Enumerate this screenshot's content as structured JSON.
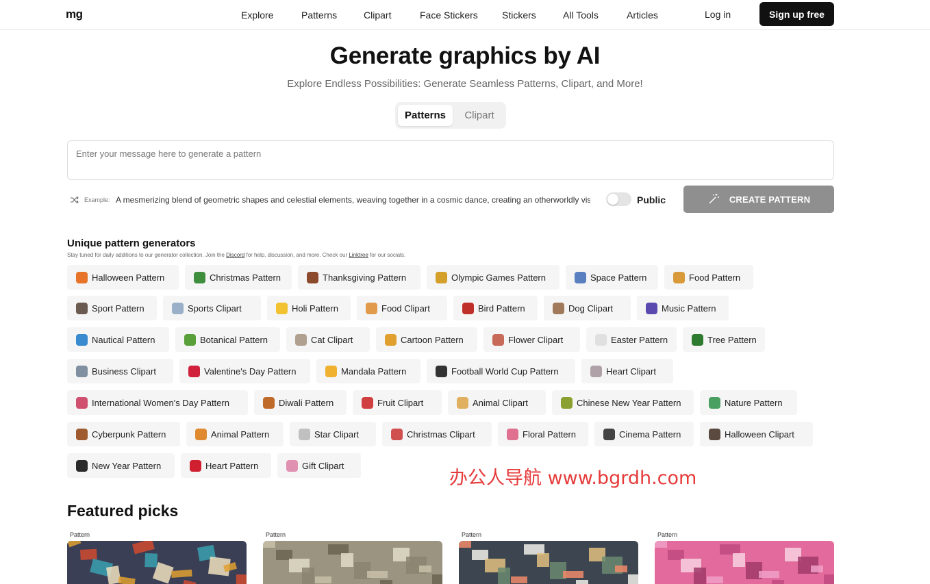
{
  "header": {
    "logo": "mg",
    "nav": [
      "Explore",
      "Patterns",
      "Clipart",
      "Face Stickers",
      "Stickers",
      "All Tools",
      "Articles"
    ],
    "login": "Log in",
    "signup": "Sign up free"
  },
  "hero": {
    "title": "Generate graphics by AI",
    "subtitle": "Explore Endless Possibilities: Generate Seamless Patterns, Clipart, and More!",
    "tabs": [
      "Patterns",
      "Clipart"
    ],
    "prompt_placeholder": "Enter your message here to generate a pattern",
    "example_label": "Example:",
    "example_text": "A mesmerizing blend of geometric shapes and celestial elements, weaving together in a cosmic dance, creating an otherworldly visual experience",
    "public_label": "Public",
    "public_on": false,
    "create_button": "CREATE PATTERN"
  },
  "generators": {
    "title": "Unique pattern generators",
    "note_before": "Stay tuned for daily additions to our generator collection. Join the ",
    "note_link1": "Discord",
    "note_mid": " for help, discussion, and more. Check our ",
    "note_link2": "Linktree",
    "note_after": " for our socials.",
    "chips": [
      "Halloween Pattern",
      "Christmas Pattern",
      "Thanksgiving Pattern",
      "Olympic Games Pattern",
      "Space Pattern",
      "Food Pattern",
      "Sport Pattern",
      "Sports Clipart",
      "Holi Pattern",
      "Food Clipart",
      "Bird Pattern",
      "Dog Clipart",
      "Music Pattern",
      "Nautical Pattern",
      "Botanical Pattern",
      "Cat Clipart",
      "Cartoon Pattern",
      "Flower Clipart",
      "Easter Pattern",
      "Tree Pattern",
      "Business Clipart",
      "Valentine's Day Pattern",
      "Mandala Pattern",
      "Football World Cup Pattern",
      "Heart Clipart",
      "International Women's Day Pattern",
      "Diwali Pattern",
      "Fruit Clipart",
      "Animal Clipart",
      "Chinese New Year Pattern",
      "Nature Pattern",
      "Cyberpunk Pattern",
      "Animal Pattern",
      "Star Clipart",
      "Christmas Clipart",
      "Floral Pattern",
      "Cinema Pattern",
      "Halloween Clipart",
      "New Year Pattern",
      "Heart Pattern",
      "Gift Clipart"
    ],
    "chip_colors": [
      "#e8742a",
      "#3e8e3e",
      "#8b4a2b",
      "#d4a02a",
      "#5a7fc0",
      "#d99a3a",
      "#6a5a50",
      "#9ab0c8",
      "#f2c230",
      "#e09a4a",
      "#c0302a",
      "#a07a5a",
      "#5a4ab0",
      "#3a8ad0",
      "#5aa03a",
      "#b0a090",
      "#e0a030",
      "#c86a5a",
      "#e0e0e0",
      "#2e7a2e",
      "#8090a0",
      "#d0203a",
      "#f0b030",
      "#333333",
      "#b0a0a8",
      "#d05070",
      "#c06a2a",
      "#d04040",
      "#e0b060",
      "#8aa030",
      "#4aa060",
      "#a05a30",
      "#e08a30",
      "#c0c0c0",
      "#d05050",
      "#e07090",
      "#444444",
      "#5a4a40",
      "#2a2a2a",
      "#d02030",
      "#e090b0"
    ]
  },
  "watermark": "办公人导航 www.bgrdh.com",
  "featured": {
    "title": "Featured picks",
    "cards": [
      {
        "label": "Pattern",
        "color": "#3a3f55"
      },
      {
        "label": "Pattern",
        "color": "#9a9480"
      },
      {
        "label": "Pattern",
        "color": "#3d4650"
      },
      {
        "label": "Pattern",
        "color": "#e26a9c"
      }
    ]
  }
}
